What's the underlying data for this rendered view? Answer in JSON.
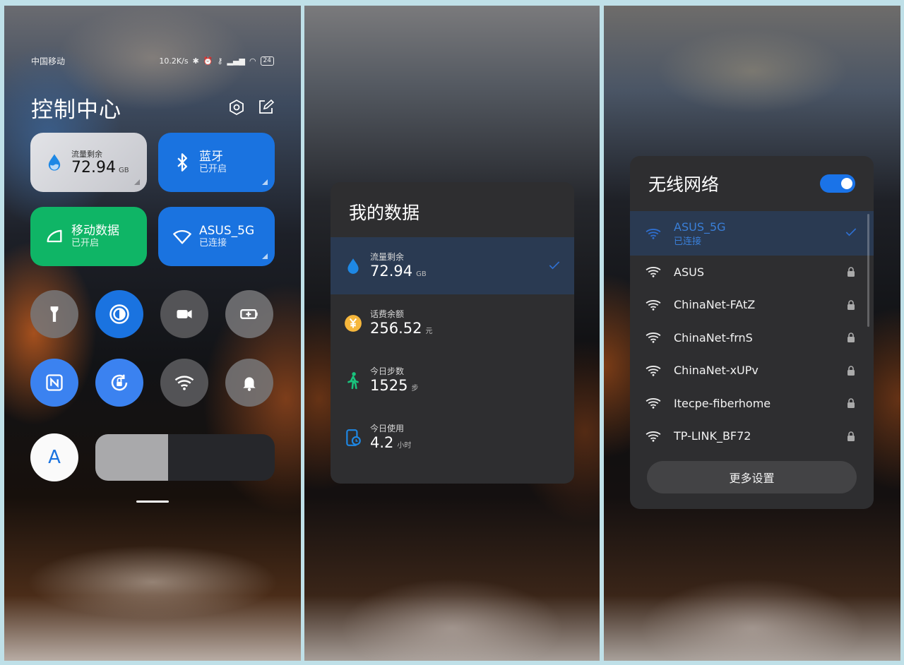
{
  "panel1": {
    "status": {
      "carrier": "中国移动",
      "speed": "10.2K/s",
      "battery": "24"
    },
    "title": "控制中心",
    "tiles": {
      "data_left": {
        "label": "流量剩余",
        "value": "72.94",
        "unit": "GB"
      },
      "bluetooth": {
        "label": "蓝牙",
        "status": "已开启"
      },
      "mobile_data": {
        "label": "移动数据",
        "status": "已开启"
      },
      "wifi": {
        "label": "ASUS_5G",
        "status": "已连接"
      }
    },
    "auto_brightness_label": "A",
    "brightness_level": 0.405
  },
  "panel2": {
    "title": "我的数据",
    "rows": [
      {
        "label": "流量剩余",
        "value": "72.94",
        "unit": "GB"
      },
      {
        "label": "话费余额",
        "value": "256.52",
        "unit": "元"
      },
      {
        "label": "今日步数",
        "value": "1525",
        "unit": "步"
      },
      {
        "label": "今日使用",
        "value": "4.2",
        "unit": "小时"
      }
    ]
  },
  "panel3": {
    "title": "无线网络",
    "connected": {
      "name": "ASUS_5G",
      "status": "已连接"
    },
    "networks": [
      "ASUS",
      "ChinaNet-FAtZ",
      "ChinaNet-frnS",
      "ChinaNet-xUPv",
      "Itecpe-fiberhome",
      "TP-LINK_BF72"
    ],
    "more_button": "更多设置"
  },
  "colors": {
    "accent_blue": "#1a73e0",
    "mobile_green": "#0fb566",
    "card_bg": "#2e2e30",
    "active_row": "#2a3a52"
  }
}
